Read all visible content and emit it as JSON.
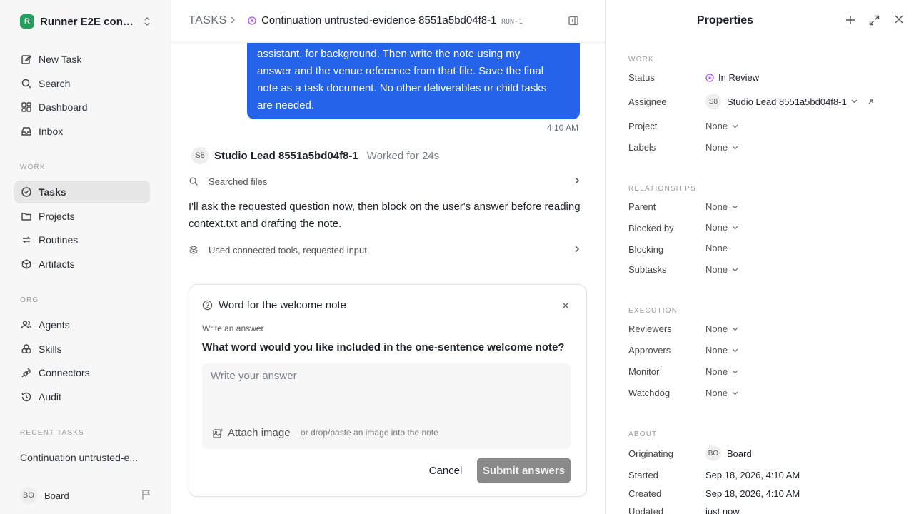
{
  "sidebar": {
    "workspace": {
      "initial": "R",
      "name": "Runner E2E conti..."
    },
    "top_items": [
      {
        "label": "New Task",
        "icon": "edit-icon"
      },
      {
        "label": "Search",
        "icon": "search-icon"
      },
      {
        "label": "Dashboard",
        "icon": "dashboard-icon"
      },
      {
        "label": "Inbox",
        "icon": "inbox-icon"
      }
    ],
    "work_label": "WORK",
    "work_items": [
      {
        "label": "Tasks",
        "icon": "tasks-icon",
        "active": true
      },
      {
        "label": "Projects",
        "icon": "folder-icon"
      },
      {
        "label": "Routines",
        "icon": "routines-icon"
      },
      {
        "label": "Artifacts",
        "icon": "box-icon"
      }
    ],
    "org_label": "ORG",
    "org_items": [
      {
        "label": "Agents",
        "icon": "users-icon"
      },
      {
        "label": "Skills",
        "icon": "skills-icon"
      },
      {
        "label": "Connectors",
        "icon": "plug-icon"
      },
      {
        "label": "Audit",
        "icon": "history-icon"
      }
    ],
    "recent_label": "RECENT TASKS",
    "recent_task": "Continuation untrusted-e...",
    "user": {
      "initials": "BO",
      "name": "Board"
    }
  },
  "topbar": {
    "root": "TASKS",
    "title": "Continuation untrusted-evidence 8551a5bd04f8-1",
    "run_tag": "RUN-1"
  },
  "thread": {
    "user_message_lines": [
      "assistant, for background. Then write the note using my",
      "answer and the venue reference from that file. Save the final",
      "note as a task document. No other deliverables or child tasks",
      "are needed."
    ],
    "user_message_time": "4:10 AM",
    "agent": {
      "initials": "S8",
      "name": "Studio Lead 8551a5bd04f8-1",
      "worked": "Worked for 24s"
    },
    "activity_1": "Searched files",
    "agent_message": "I'll ask the requested question now, then block on the user's answer before reading context.txt and drafting the note.",
    "activity_2": "Used connected tools, requested input"
  },
  "question": {
    "title": "Word for the welcome note",
    "subtitle": "Write an answer",
    "text": "What word would you like included in the one-sentence welcome note?",
    "placeholder": "Write your answer",
    "attach_label": "Attach image",
    "drop_hint": "or drop/paste an image into the note",
    "cancel_label": "Cancel",
    "submit_label": "Submit answers"
  },
  "properties": {
    "title": "Properties",
    "work_label": "WORK",
    "status_label": "Status",
    "status_value": "In Review",
    "status_color": "#a855f7",
    "assignee_label": "Assignee",
    "assignee_initials": "S8",
    "assignee_value": "Studio Lead 8551a5bd04f8-1",
    "project_label": "Project",
    "labels_label": "Labels",
    "relationships_label": "RELATIONSHIPS",
    "parent_label": "Parent",
    "blocked_by_label": "Blocked by",
    "blocking_label": "Blocking",
    "subtasks_label": "Subtasks",
    "execution_label": "EXECUTION",
    "reviewers_label": "Reviewers",
    "approvers_label": "Approvers",
    "monitor_label": "Monitor",
    "watchdog_label": "Watchdog",
    "about_label": "ABOUT",
    "originating_label": "Originating",
    "originating_initials": "BO",
    "originating_value": "Board",
    "started_label": "Started",
    "started_value": "Sep 18, 2026, 4:10 AM",
    "created_label": "Created",
    "created_value": "Sep 18, 2026, 4:10 AM",
    "updated_label": "Updated",
    "updated_value": "just now",
    "none": "None"
  },
  "colors": {
    "accent_blue": "#2563eb",
    "brand_green": "#22a05b",
    "submit_disabled": "#8a8a8a"
  }
}
